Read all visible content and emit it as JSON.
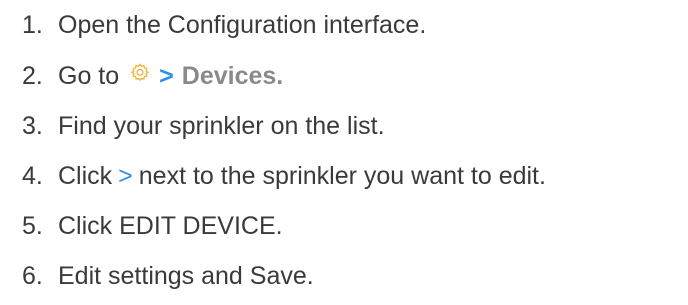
{
  "steps": [
    {
      "number": "1.",
      "text": "Open the Configuration interface."
    },
    {
      "number": "2.",
      "prefix": "Go to",
      "icon": "gear-icon",
      "chevron": ">",
      "target": "Devices."
    },
    {
      "number": "3.",
      "text": "Find your sprinkler on the list."
    },
    {
      "number": "4.",
      "prefix": "Click",
      "chevron": ">",
      "suffix": "next to the sprinkler you want to edit."
    },
    {
      "number": "5.",
      "text": "Click EDIT DEVICE."
    },
    {
      "number": "6.",
      "text": "Edit settings and Save."
    }
  ],
  "colors": {
    "text": "#3a3a3a",
    "accent": "#2f8fea",
    "muted": "#8a8a8a"
  }
}
